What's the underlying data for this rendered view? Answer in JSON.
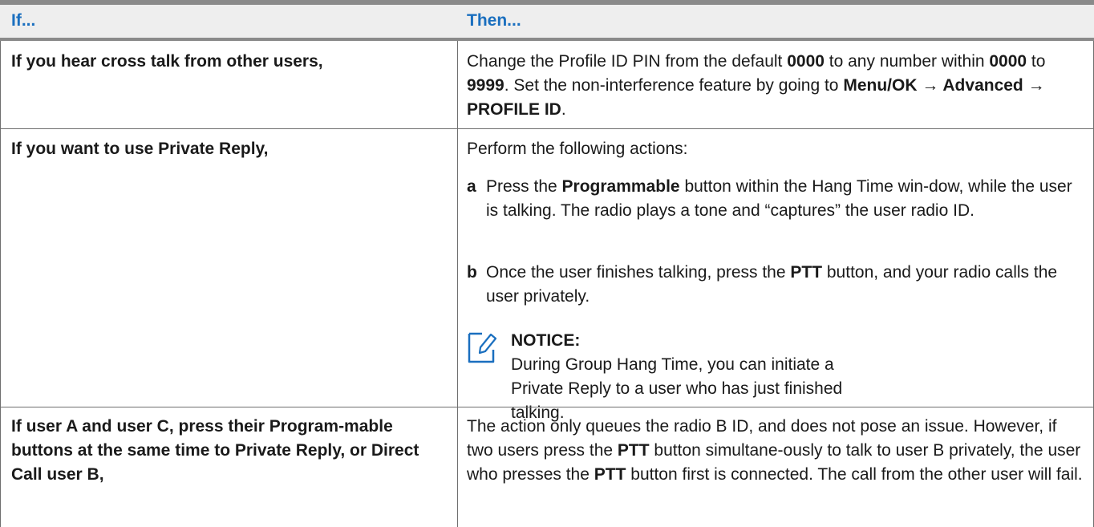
{
  "header": {
    "if_label": "If...",
    "then_label": "Then..."
  },
  "rows": [
    {
      "if": "If you hear cross talk from other users,",
      "then": {
        "t1": "Change the Profile ID PIN from the default ",
        "b1": "0000",
        "t2": " to any number within ",
        "b2": "0000",
        "t3": " to ",
        "b3": "9999",
        "t4": ". Set the non-interference feature by going to ",
        "b4": "Menu/OK",
        "t5": " → ",
        "b5": "Advanced",
        "t6": " → ",
        "b6": "PROFILE ID",
        "t7": "."
      }
    },
    {
      "if": "If you want to use Private Reply,",
      "then": {
        "intro": "Perform the following actions:",
        "steps": [
          {
            "letter": "a",
            "t1": "Press the ",
            "b1": "Programmable",
            "t2": " button within the Hang Time win-dow, while the user is talking. The radio plays a tone and “captures” the user radio ID."
          },
          {
            "letter": "b",
            "t1": "Once the user finishes talking, press the ",
            "b1": "PTT",
            "t2": " button, and your radio calls the user privately."
          }
        ],
        "notice": {
          "icon": "note-pencil-icon",
          "title": "NOTICE:",
          "body": "During Group Hang Time, you can initiate a Private Reply to a user who has just finished talking."
        }
      }
    },
    {
      "if": "If user A and user C, press their Program-mable buttons at the same time to Private Reply, or Direct Call user B,",
      "then": {
        "t1": "The action only queues the radio B ID, and does not pose an issue. However, if two users press the ",
        "b1": "PTT",
        "t2": " button simultane-ously to talk to user B privately, the user who presses the ",
        "b2": "PTT",
        "t3": " button first is connected. The call from the other user will fail."
      }
    }
  ]
}
